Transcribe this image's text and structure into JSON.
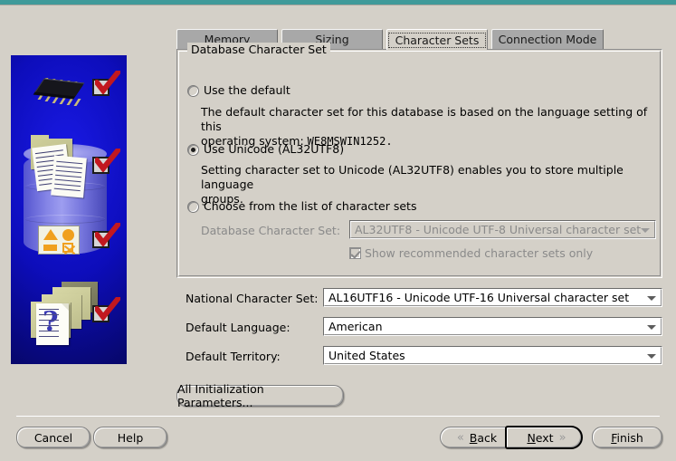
{
  "window": {
    "accent_color": "#3f9a9a",
    "background_color": "#d4d0c8"
  },
  "illustration": {
    "name": "oracle-dbca-steps-illustration",
    "background_color": "#0d0dbb",
    "checkmark_color": "#c2181f",
    "items": [
      "chip-icon",
      "database-cylinder-icon",
      "shapes-icon",
      "folders-question-icon"
    ],
    "checkmarks": 4
  },
  "tabs": [
    {
      "label": "Memory",
      "active": false
    },
    {
      "label": "Sizing",
      "active": false
    },
    {
      "label": "Character Sets",
      "active": true
    },
    {
      "label": "Connection Mode",
      "active": false
    }
  ],
  "groupbox": {
    "legend": "Database Character Set"
  },
  "options": [
    {
      "label": "Use the default",
      "selected": false,
      "description_line1": "The default character set for this database is based on the language setting of this",
      "description_line2_prefix": "operating system: ",
      "description_line2_value": "WE8MSWIN1252."
    },
    {
      "label": "Use Unicode (AL32UTF8)",
      "selected": true,
      "description_line1": "Setting character set to Unicode (AL32UTF8) enables you to store multiple language",
      "description_line2_prefix": "groups.",
      "description_line2_value": ""
    },
    {
      "label": "Choose from the list of character sets",
      "selected": false
    }
  ],
  "database_character_set": {
    "label": "Database Character Set:",
    "value": "AL32UTF8 - Unicode UTF-8 Universal character set",
    "disabled": true
  },
  "recommended_checkbox": {
    "label": "Show recommended character sets only",
    "checked": true,
    "disabled": true
  },
  "fields": [
    {
      "label": "National Character Set:",
      "value": "AL16UTF16 - Unicode UTF-16 Universal character set"
    },
    {
      "label": "Default Language:",
      "value": "American"
    },
    {
      "label": "Default Territory:",
      "value": "United States"
    }
  ],
  "buttons": {
    "all_init_params": "All Initialization Parameters...",
    "cancel": "Cancel",
    "help": "Help",
    "back": "Back",
    "back_mnemonic": "B",
    "next": "Next",
    "next_mnemonic": "N",
    "finish": "Finish",
    "finish_mnemonic": "F",
    "back_chevron": "«",
    "next_chevron": "»"
  }
}
